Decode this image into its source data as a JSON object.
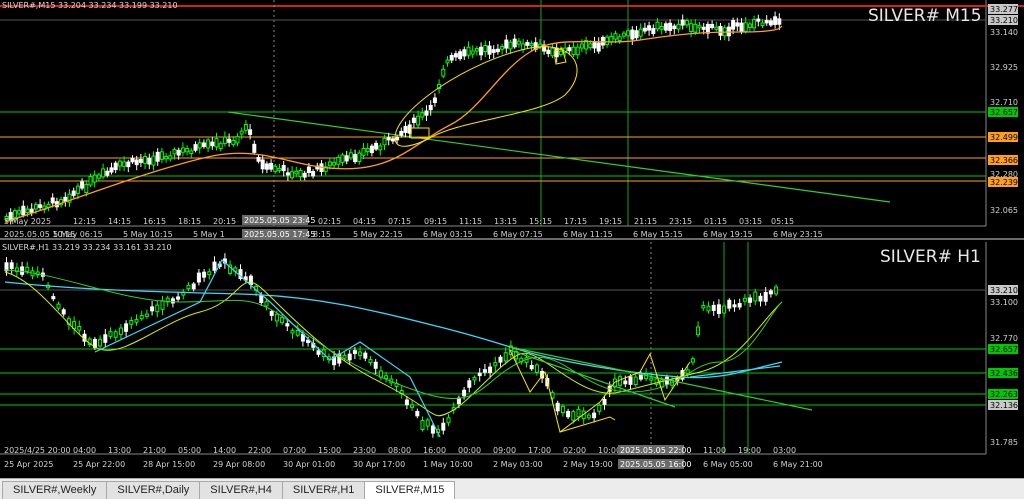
{
  "top": {
    "header": "SILVER#,M15  33.204 33.234 33.199 33.210",
    "big_label": "SILVER# M15",
    "y_labels": [
      "33.277",
      "33.210",
      "33.140",
      "32.925",
      "32.710",
      "32.657",
      "32.499",
      "32.366",
      "32.280",
      "32.239",
      "32.065"
    ],
    "x_labels": [
      "5 May 2025",
      "12:15",
      "14:15",
      "16:15",
      "18:15",
      "20:15",
      "02:15",
      "04:15",
      "07:15",
      "09:15",
      "11:15",
      "13:15",
      "15:15",
      "17:15",
      "19:15",
      "21:15",
      "23:15",
      "01:15",
      "03:15",
      "05:15"
    ],
    "x_labels_2": [
      "2025.05.05 10:15",
      "5 May 06:15",
      "5 May 10:15",
      "5 May 1",
      "8:15",
      "5 May 22:15",
      "6 May 03:15",
      "6 May 07:15",
      "6 May 11:15",
      "6 May 15:15",
      "6 May 19:15",
      "6 May 23:15"
    ],
    "cursor_time_1": "2025.05.05 23:45",
    "cursor_time_2": "2025.05.05 17:45",
    "levels": [
      {
        "price": "32.657",
        "color": "#00c800"
      },
      {
        "price": "32.499",
        "color": "#ff9f1a"
      },
      {
        "price": "32.366",
        "color": "#ff9f1a"
      },
      {
        "price": "32.239",
        "color": "#ff9f1a"
      }
    ]
  },
  "bottom": {
    "header": "SILVER#,H1  33.219 33.234 33.161 33.210",
    "big_label": "SILVER# H1",
    "y_labels": [
      "33.210",
      "33.100",
      "32.770",
      "32.657",
      "32.436",
      "32.263",
      "32.136",
      "31.785"
    ],
    "x_labels": [
      "2025/4/25 20:00",
      "04:00",
      "13:00",
      "21:00",
      "05:00",
      "14:00",
      "22:00",
      "07:00",
      "15:00",
      "23:00",
      "08:00",
      "16:00",
      "00:00",
      "09:00",
      "17:00",
      "02:00",
      "10:00",
      "11:00",
      "19:00",
      "03:00"
    ],
    "x_labels_2": [
      "25 Apr 2025",
      "25 Apr 22:00",
      "28 Apr 15:00",
      "29 Apr 08:00",
      "30 Apr 01:00",
      "30 Apr 17:00",
      "1 May 10:00",
      "2 May 03:00",
      "2 May 19:00",
      "6 May 05:00",
      "6 May 21:00"
    ],
    "cursor_time_1": "2025.05.05 22:00",
    "cursor_time_2": "2025.05.05 16:00"
  },
  "tabs": [
    "SILVER#,Weekly",
    "SILVER#,Daily",
    "SILVER#,H4",
    "SILVER#,H1",
    "SILVER#,M15"
  ],
  "active_tab": "SILVER#,M15",
  "colors": {
    "bull": "#00ff00",
    "bear": "#ffffff",
    "ma_orange": "#ff9f1a",
    "ma_cyan": "#3fd6f5",
    "ma_green": "#32cd32",
    "drawing_yellow": "#ffe600",
    "level_green": "#00c800"
  }
}
